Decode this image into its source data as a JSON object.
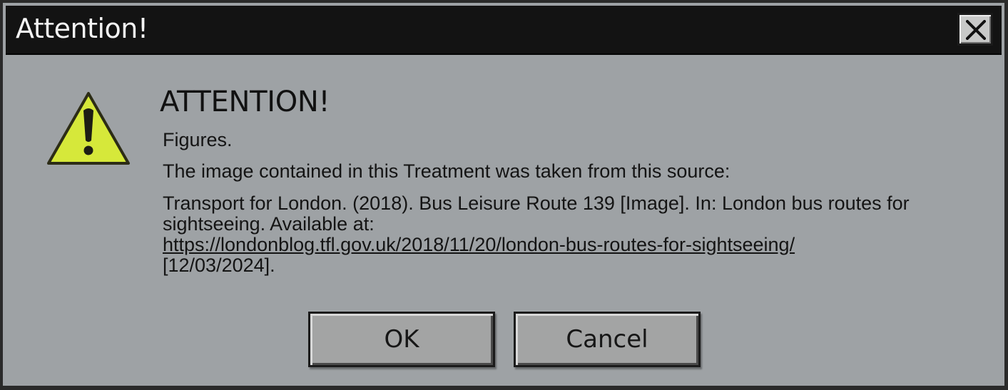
{
  "window": {
    "title": "Attention!",
    "close_icon": "close-icon"
  },
  "message": {
    "icon": "warning-icon",
    "heading": "ATTENTION!",
    "figures": "Figures.",
    "source_intro": "The image contained in this Treatment was taken from this source:",
    "citation_text": "Transport for London. (2018). Bus Leisure Route 139 [Image]. In: London bus routes for sightseeing. Available at:",
    "citation_url": "https://londonblog.tfl.gov.uk/2018/11/20/london-bus-routes-for-sightseeing/",
    "citation_date": "[12/03/2024]."
  },
  "buttons": {
    "ok_label": "OK",
    "cancel_label": "Cancel"
  },
  "colors": {
    "titlebar": "#131313",
    "dialog_background": "#9ea2a5",
    "warning_yellow": "#d6e83a"
  }
}
